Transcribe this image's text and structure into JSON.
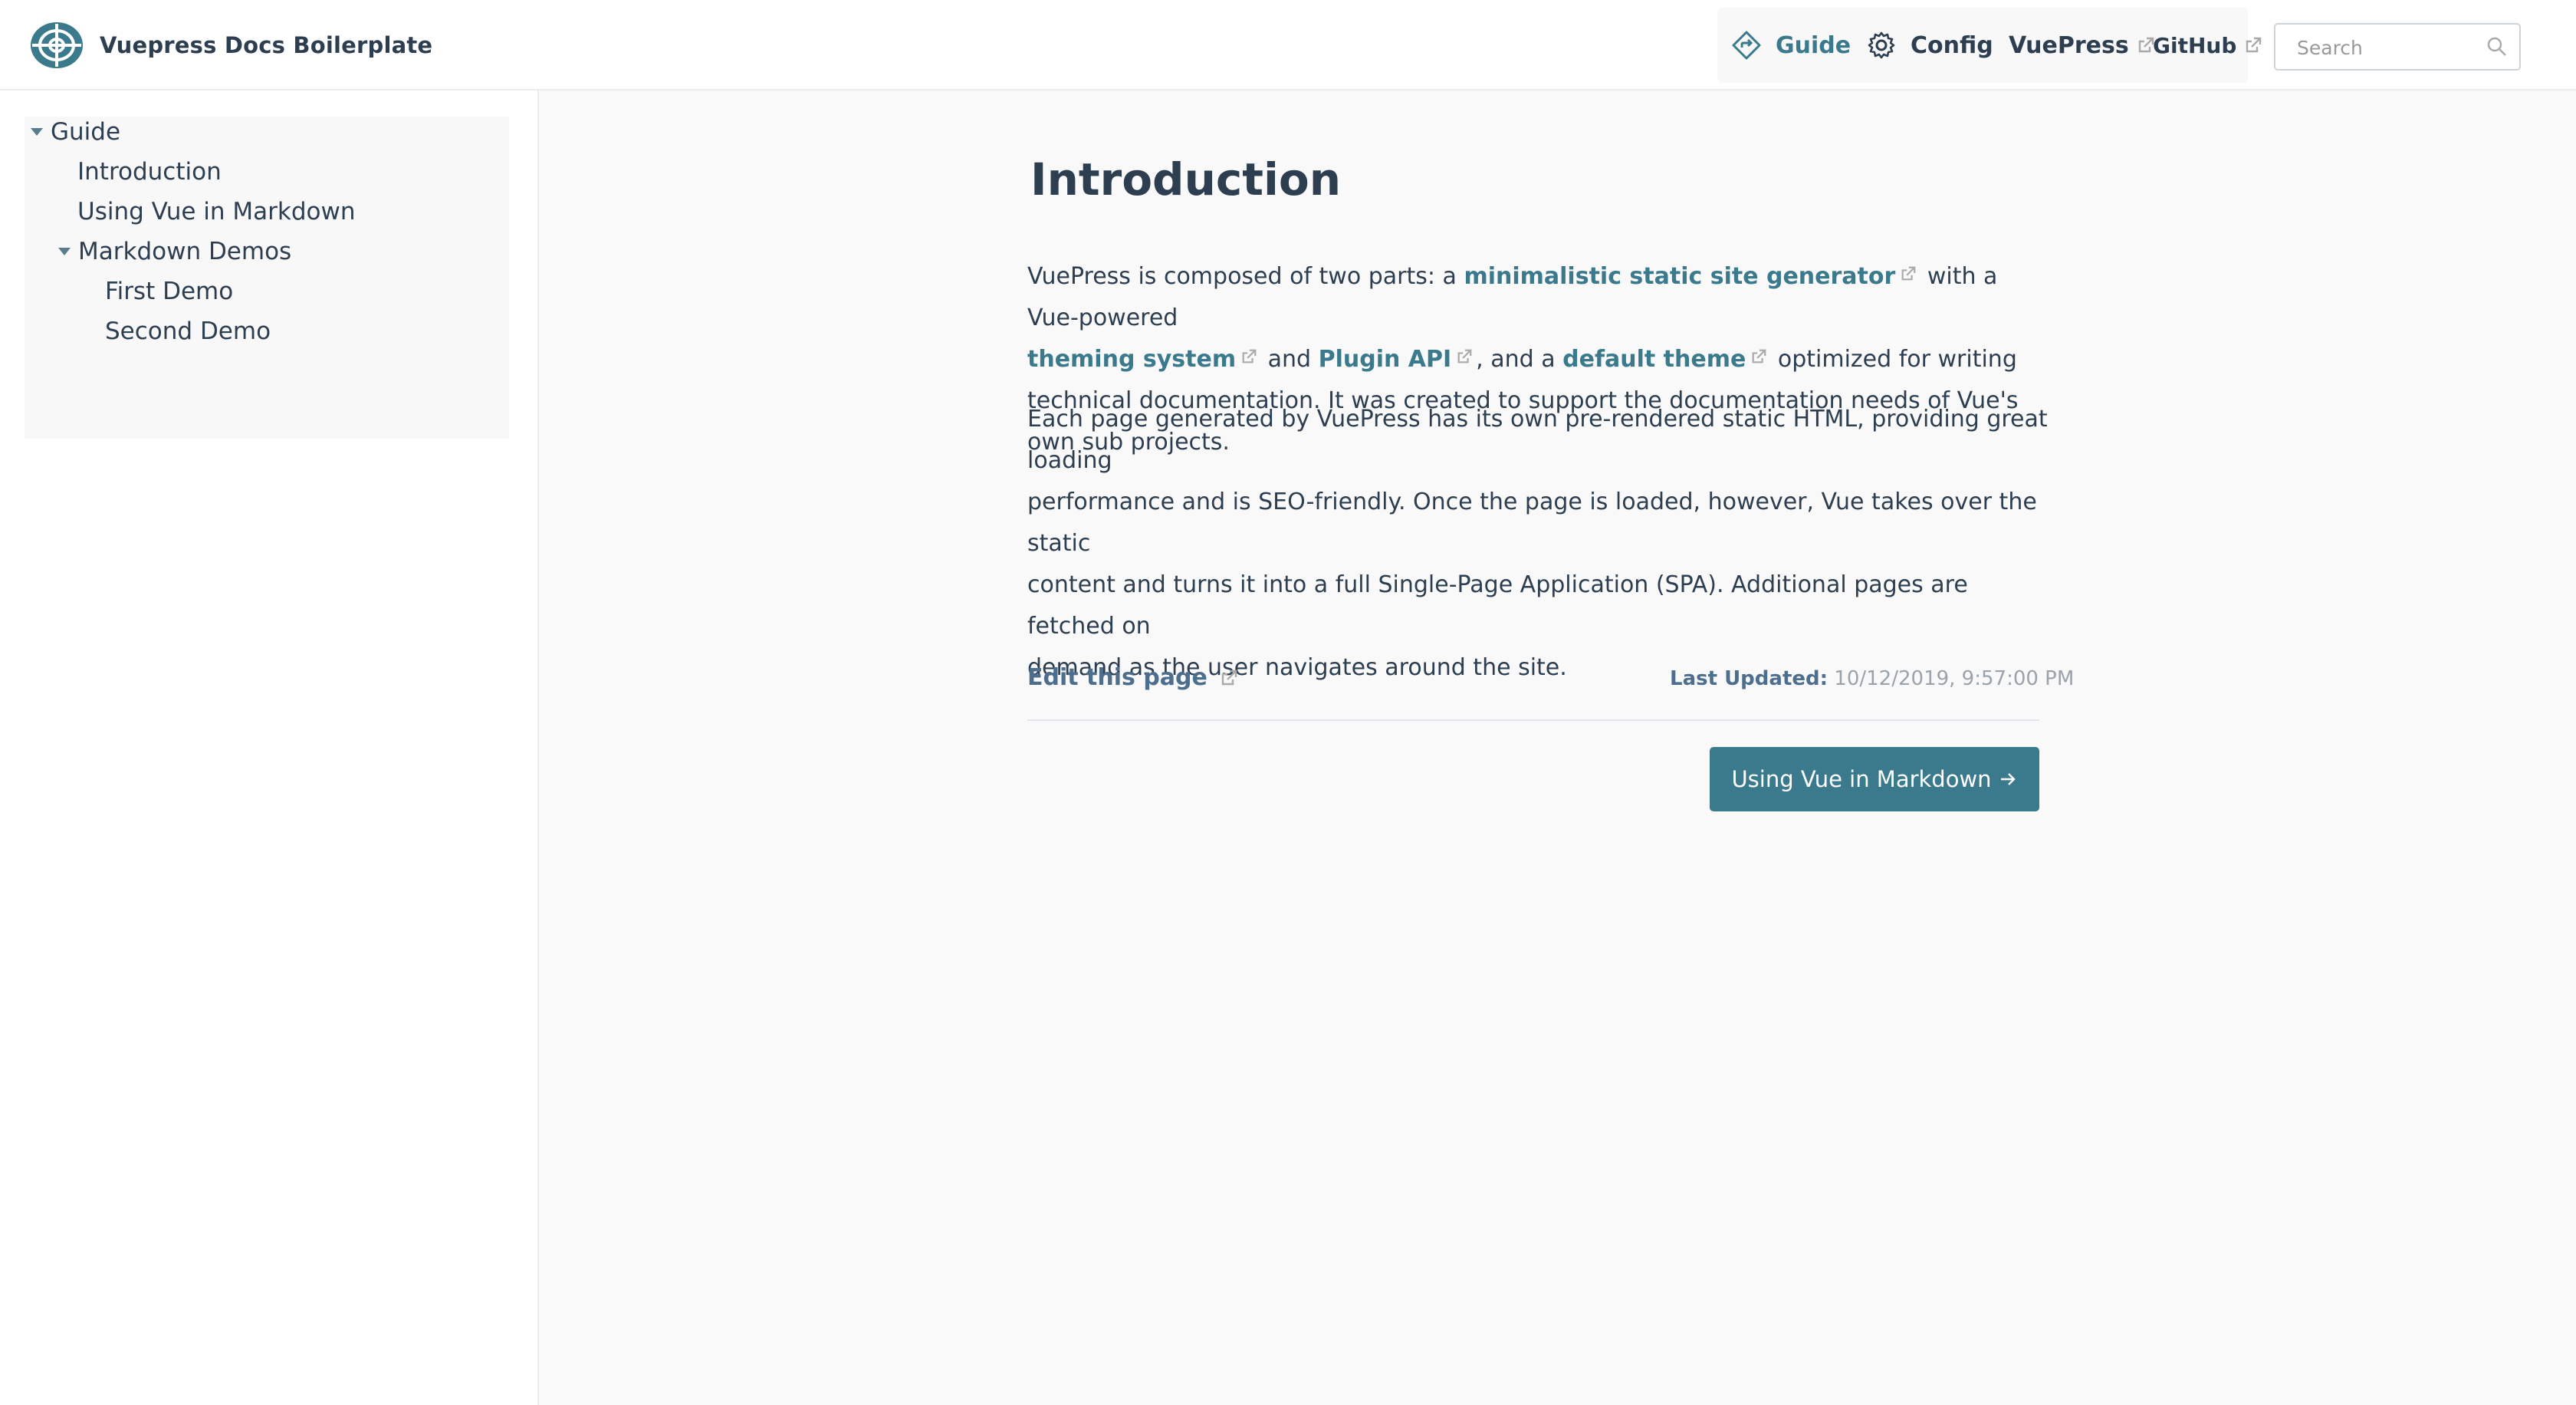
{
  "header": {
    "site_name": "Vuepress Docs Boilerplate",
    "nav": {
      "guide": "Guide",
      "config": "Config",
      "vuepress": "VuePress",
      "github": "GitHub"
    },
    "search": {
      "placeholder": "Search"
    }
  },
  "sidebar": {
    "group_guide": "Guide",
    "introduction": "Introduction",
    "using_vue": "Using Vue in Markdown",
    "group_demos": "Markdown Demos",
    "first_demo": "First Demo",
    "second_demo": "Second Demo"
  },
  "content": {
    "title": "Introduction",
    "p1": {
      "t1": "VuePress is composed of two parts: a ",
      "link1": "minimalistic static site generator",
      "t2": " with a Vue-powered",
      "link2": "theming system",
      "t3": " and ",
      "link3": "Plugin API",
      "t4": ", and a ",
      "link4": "default theme",
      "t5": " optimized for writing technical documentation. It was created to support the documentation needs of Vue's own sub projects."
    },
    "p2_l1": "Each page generated by VuePress has its own pre-rendered static HTML, providing great loading",
    "p2_l2": "performance and is SEO-friendly. Once the page is loaded, however, Vue takes over the static",
    "p2_l3": "content and turns it into a full Single-Page Application (SPA). Additional pages are fetched on",
    "p2_l4": "demand as the user navigates around the site.",
    "edit_link": "Edit this page",
    "last_updated_label": "Last Updated:",
    "last_updated_value": "10/12/2019, 9:57:00 PM",
    "next_button": "Using Vue in Markdown"
  },
  "colors": {
    "accent": "#3a7a8c",
    "text": "#2c3e50",
    "content_bg": "#f9f9f9"
  },
  "icons": [
    "logo-icon",
    "guide-icon",
    "gear-icon",
    "external-link-icon",
    "search-icon",
    "caret-down-icon",
    "arrow-right-icon"
  ]
}
